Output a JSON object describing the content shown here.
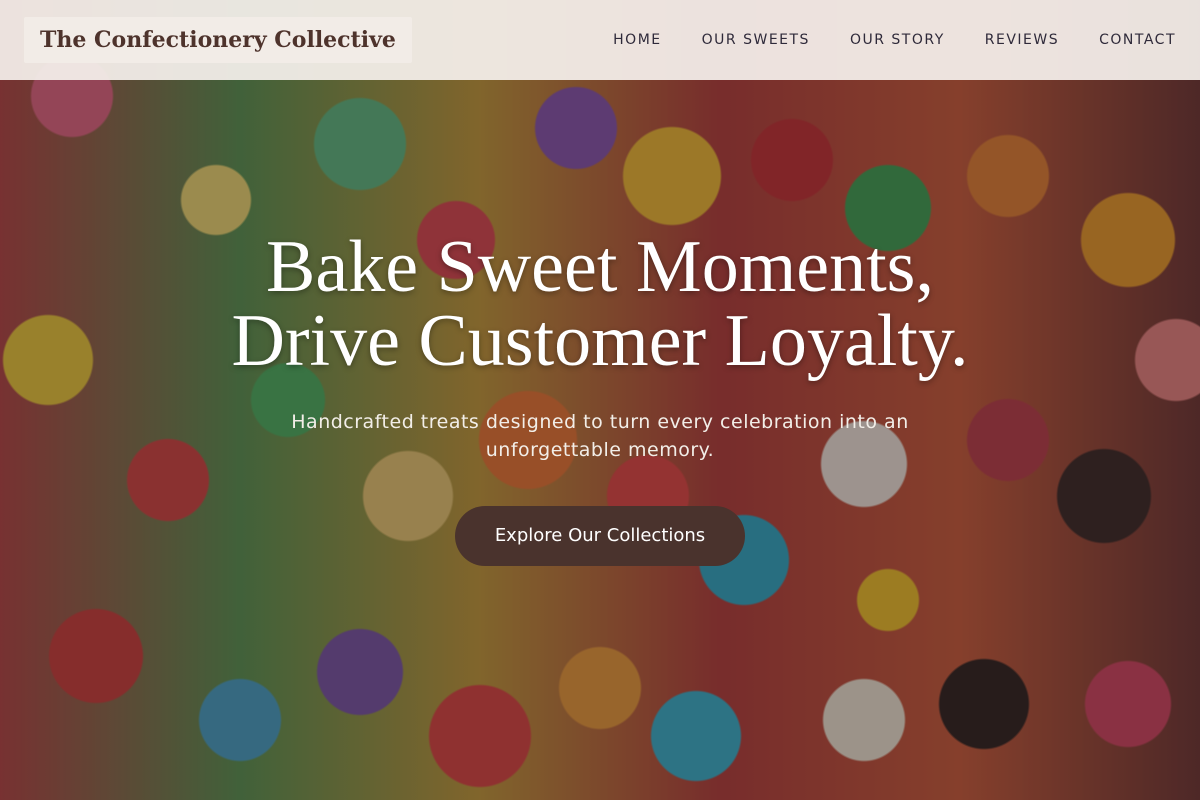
{
  "header": {
    "brand": "The Confectionery Collective",
    "nav": [
      {
        "label": "HOME"
      },
      {
        "label": "OUR SWEETS"
      },
      {
        "label": "OUR STORY"
      },
      {
        "label": "REVIEWS"
      },
      {
        "label": "CONTACT"
      }
    ]
  },
  "hero": {
    "title_line1": "Bake Sweet Moments,",
    "title_line2": "Drive Customer Loyalty.",
    "subtitle": "Handcrafted treats designed to turn every celebration into an unforgettable memory.",
    "cta_label": "Explore Our Collections",
    "background": "candy-collage-image"
  },
  "colors": {
    "brand_text": "#4e332c",
    "header_bg": "#f5f0ec",
    "cta_bg": "#4a332d",
    "hero_text": "#ffffff"
  }
}
